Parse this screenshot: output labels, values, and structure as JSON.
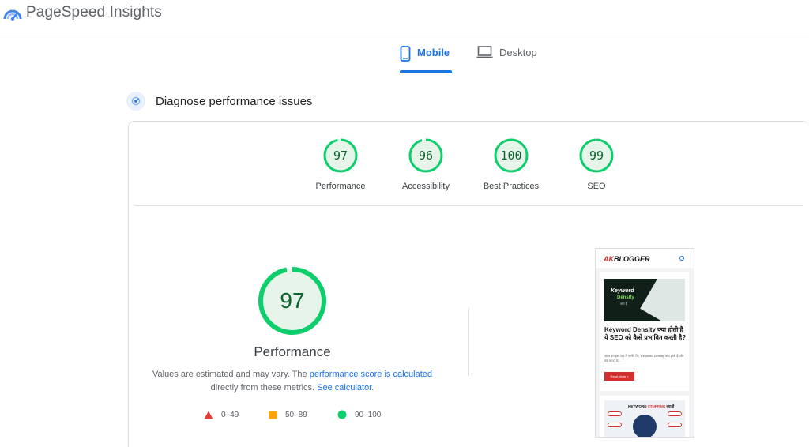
{
  "app": {
    "title": "PageSpeed Insights"
  },
  "tabs": [
    {
      "label": "Mobile",
      "active": true,
      "icon": "smartphone-icon"
    },
    {
      "label": "Desktop",
      "active": false,
      "icon": "laptop-icon"
    }
  ],
  "diagnose": {
    "title": "Diagnose performance issues",
    "icon": "speed-dial-icon"
  },
  "scores": [
    {
      "label": "Performance",
      "value": 97
    },
    {
      "label": "Accessibility",
      "value": 96
    },
    {
      "label": "Best Practices",
      "value": 100
    },
    {
      "label": "SEO",
      "value": 99
    }
  ],
  "main_score": {
    "value": "97",
    "label": "Performance",
    "note_before": "Values are estimated and may vary. The ",
    "note_link1": "performance score is calculated",
    "note_mid": " directly from these metrics. ",
    "note_link2": "See calculator",
    "note_end": "."
  },
  "legend": [
    {
      "range": "0–49",
      "shape": "triangle",
      "color": "#e53935"
    },
    {
      "range": "50–89",
      "shape": "square",
      "color": "#ffa400"
    },
    {
      "range": "90–100",
      "shape": "circle",
      "color": "#0cce6b"
    }
  ],
  "colors": {
    "pass": "#0cce6b",
    "pass_bg": "#e6f4ea",
    "pass_text": "#0d652d",
    "accent": "#1a73e8"
  },
  "screenshot": {
    "brand_prefix": "AK",
    "brand_suffix": "BLOGGER",
    "thumb_line1": "Keyword",
    "thumb_line2": "Density",
    "thumb_line3": "क्या है",
    "post_title": "Keyword Density क्या होती है ये SEO को कैसे प्रभावित करती है?",
    "post_excerpt": "आज हम इस पाठ में जानेंगे कि \"Keyword Density क्या होती है और यह SEO प्र...",
    "read_more": "Read More »",
    "post2_prefix": "KEYWORD ",
    "post2_highlight": "STUFFING",
    "post2_suffix": " क्या है"
  }
}
